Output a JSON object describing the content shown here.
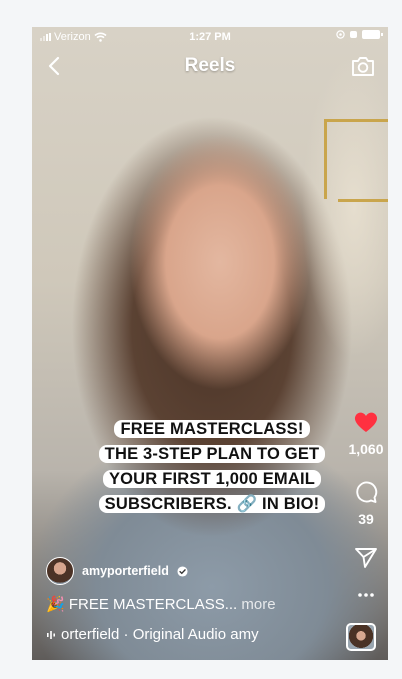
{
  "status_bar": {
    "carrier": "Verizon",
    "time": "1:27 PM"
  },
  "header": {
    "title": "Reels"
  },
  "video_caption": {
    "lines": [
      "FREE MASTERCLASS!",
      "THE 3-STEP PLAN TO GET",
      "YOUR FIRST 1,000 EMAIL",
      "SUBSCRIBERS. 🔗 IN BIO!"
    ]
  },
  "actions": {
    "likes": "1,060",
    "comments": "39"
  },
  "author": {
    "username": "amyporterfield"
  },
  "post": {
    "caption": "🎉 FREE MASTERCLASS...",
    "more_label": "more",
    "audio": "orterfield · Original Audio  amy"
  },
  "colors": {
    "like_heart": "#ff3040",
    "caption_bg": "#ffffff"
  },
  "icons": [
    "wifi-icon",
    "back-icon",
    "camera-icon",
    "heart-icon",
    "comment-icon",
    "share-icon",
    "more-icon",
    "verified-icon",
    "audio-icon"
  ]
}
